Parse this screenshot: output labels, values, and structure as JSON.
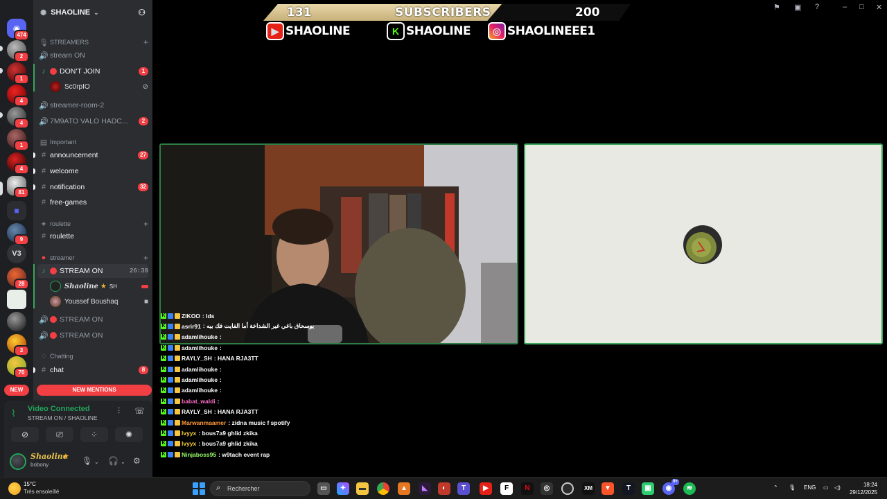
{
  "rail": {
    "home_badge": "474",
    "badges": [
      "2",
      "1",
      "4",
      "4",
      "1",
      "4",
      "81",
      "9",
      "28",
      "3",
      "70"
    ],
    "v3_label": "V3"
  },
  "server": {
    "name": "SHAOLINE",
    "categories": {
      "streamers": "STREAMERS",
      "important": "Important",
      "roulette": "roulette",
      "streamer": "streamer",
      "chatting": "Chatting"
    },
    "channels": {
      "stream_on_1": "stream ON",
      "dont_join": "DON'T JOIN",
      "dont_join_badge": "1",
      "sc0rpio": "Sc0rpIO",
      "streamer_room_2": "streamer-room-2",
      "valo": "7M9ATO VALO HADC...",
      "valo_badge": "2",
      "announcement": "announcement",
      "announcement_badge": "27",
      "welcome": "welcome",
      "notification": "notification",
      "notification_badge": "32",
      "free_games": "free-games",
      "roulette": "roulette",
      "stream_on_live": "STREAM ON",
      "stream_time": "26:30",
      "user_shaoline": "Shaoline",
      "user_shaoline_tag": "SH",
      "user_youssef": "Youssef Boushaq",
      "stream_on_2": "STREAM ON",
      "stream_on_3": "STREAM ON",
      "chat": "chat",
      "chat_badge": "8"
    },
    "new_label": "NEW",
    "new_mentions": "NEW MENTIONS"
  },
  "voice": {
    "status": "Video Connected",
    "channel": "STREAM ON / SHAOLINE",
    "user_name": "Shaoline",
    "user_status": "bobony"
  },
  "overlay": {
    "subs_current": "131",
    "subs_label": "SUBSCRIBERS",
    "subs_goal": "200",
    "youtube": "SHAOLINE",
    "kick": "SHAOLINE",
    "instagram": "SHAOLINEEE1"
  },
  "chat": [
    {
      "user": "ZIKOO",
      "text": ": lds",
      "color": "#ffffff"
    },
    {
      "user": "asrir91",
      "text": ": يوسحاق باغي غير الشداخة أما الفايت فك بيه",
      "color": "#ffffff"
    },
    {
      "user": "adamlihouke",
      "text": ":",
      "color": "#ffffff"
    },
    {
      "user": "adamlihouke",
      "text": ":",
      "color": "#ffffff"
    },
    {
      "user": "RAYLY_SH",
      "text": ": HANA RJA3TT",
      "color": "#ffffff"
    },
    {
      "user": "adamlihouke",
      "text": ":",
      "color": "#ffffff"
    },
    {
      "user": "adamlihouke",
      "text": ":",
      "color": "#ffffff"
    },
    {
      "user": "adamlihouke",
      "text": ":",
      "color": "#ffffff"
    },
    {
      "user": "babat_waldi",
      "text": ":",
      "color": "#ff6ec7"
    },
    {
      "user": "RAYLY_SH",
      "text": ": HANA RJA3TT",
      "color": "#ffffff"
    },
    {
      "user": "Marwanmaamer",
      "text": ": zidna music f spotify",
      "color": "#ff9a3c"
    },
    {
      "user": "lvyyx",
      "text": ": bous7a9 ghlid zkika",
      "color": "#ffd23c"
    },
    {
      "user": "lvyyx",
      "text": ": bous7a9 ghlid zkika",
      "color": "#ffd23c"
    },
    {
      "user": "Ninjaboss95",
      "text": ": w9tach event rap",
      "color": "#9aff6b"
    }
  ],
  "taskbar": {
    "temp": "15°C",
    "weather": "Très ensoleillé",
    "search_placeholder": "Rechercher",
    "lang": "ENG",
    "time": "18:24",
    "date": "29/12/2025",
    "discord_badge": "9+"
  },
  "colors": {
    "accent_red": "#f23f43",
    "voice_green": "#23a55a",
    "kick_green": "#53fc18"
  }
}
